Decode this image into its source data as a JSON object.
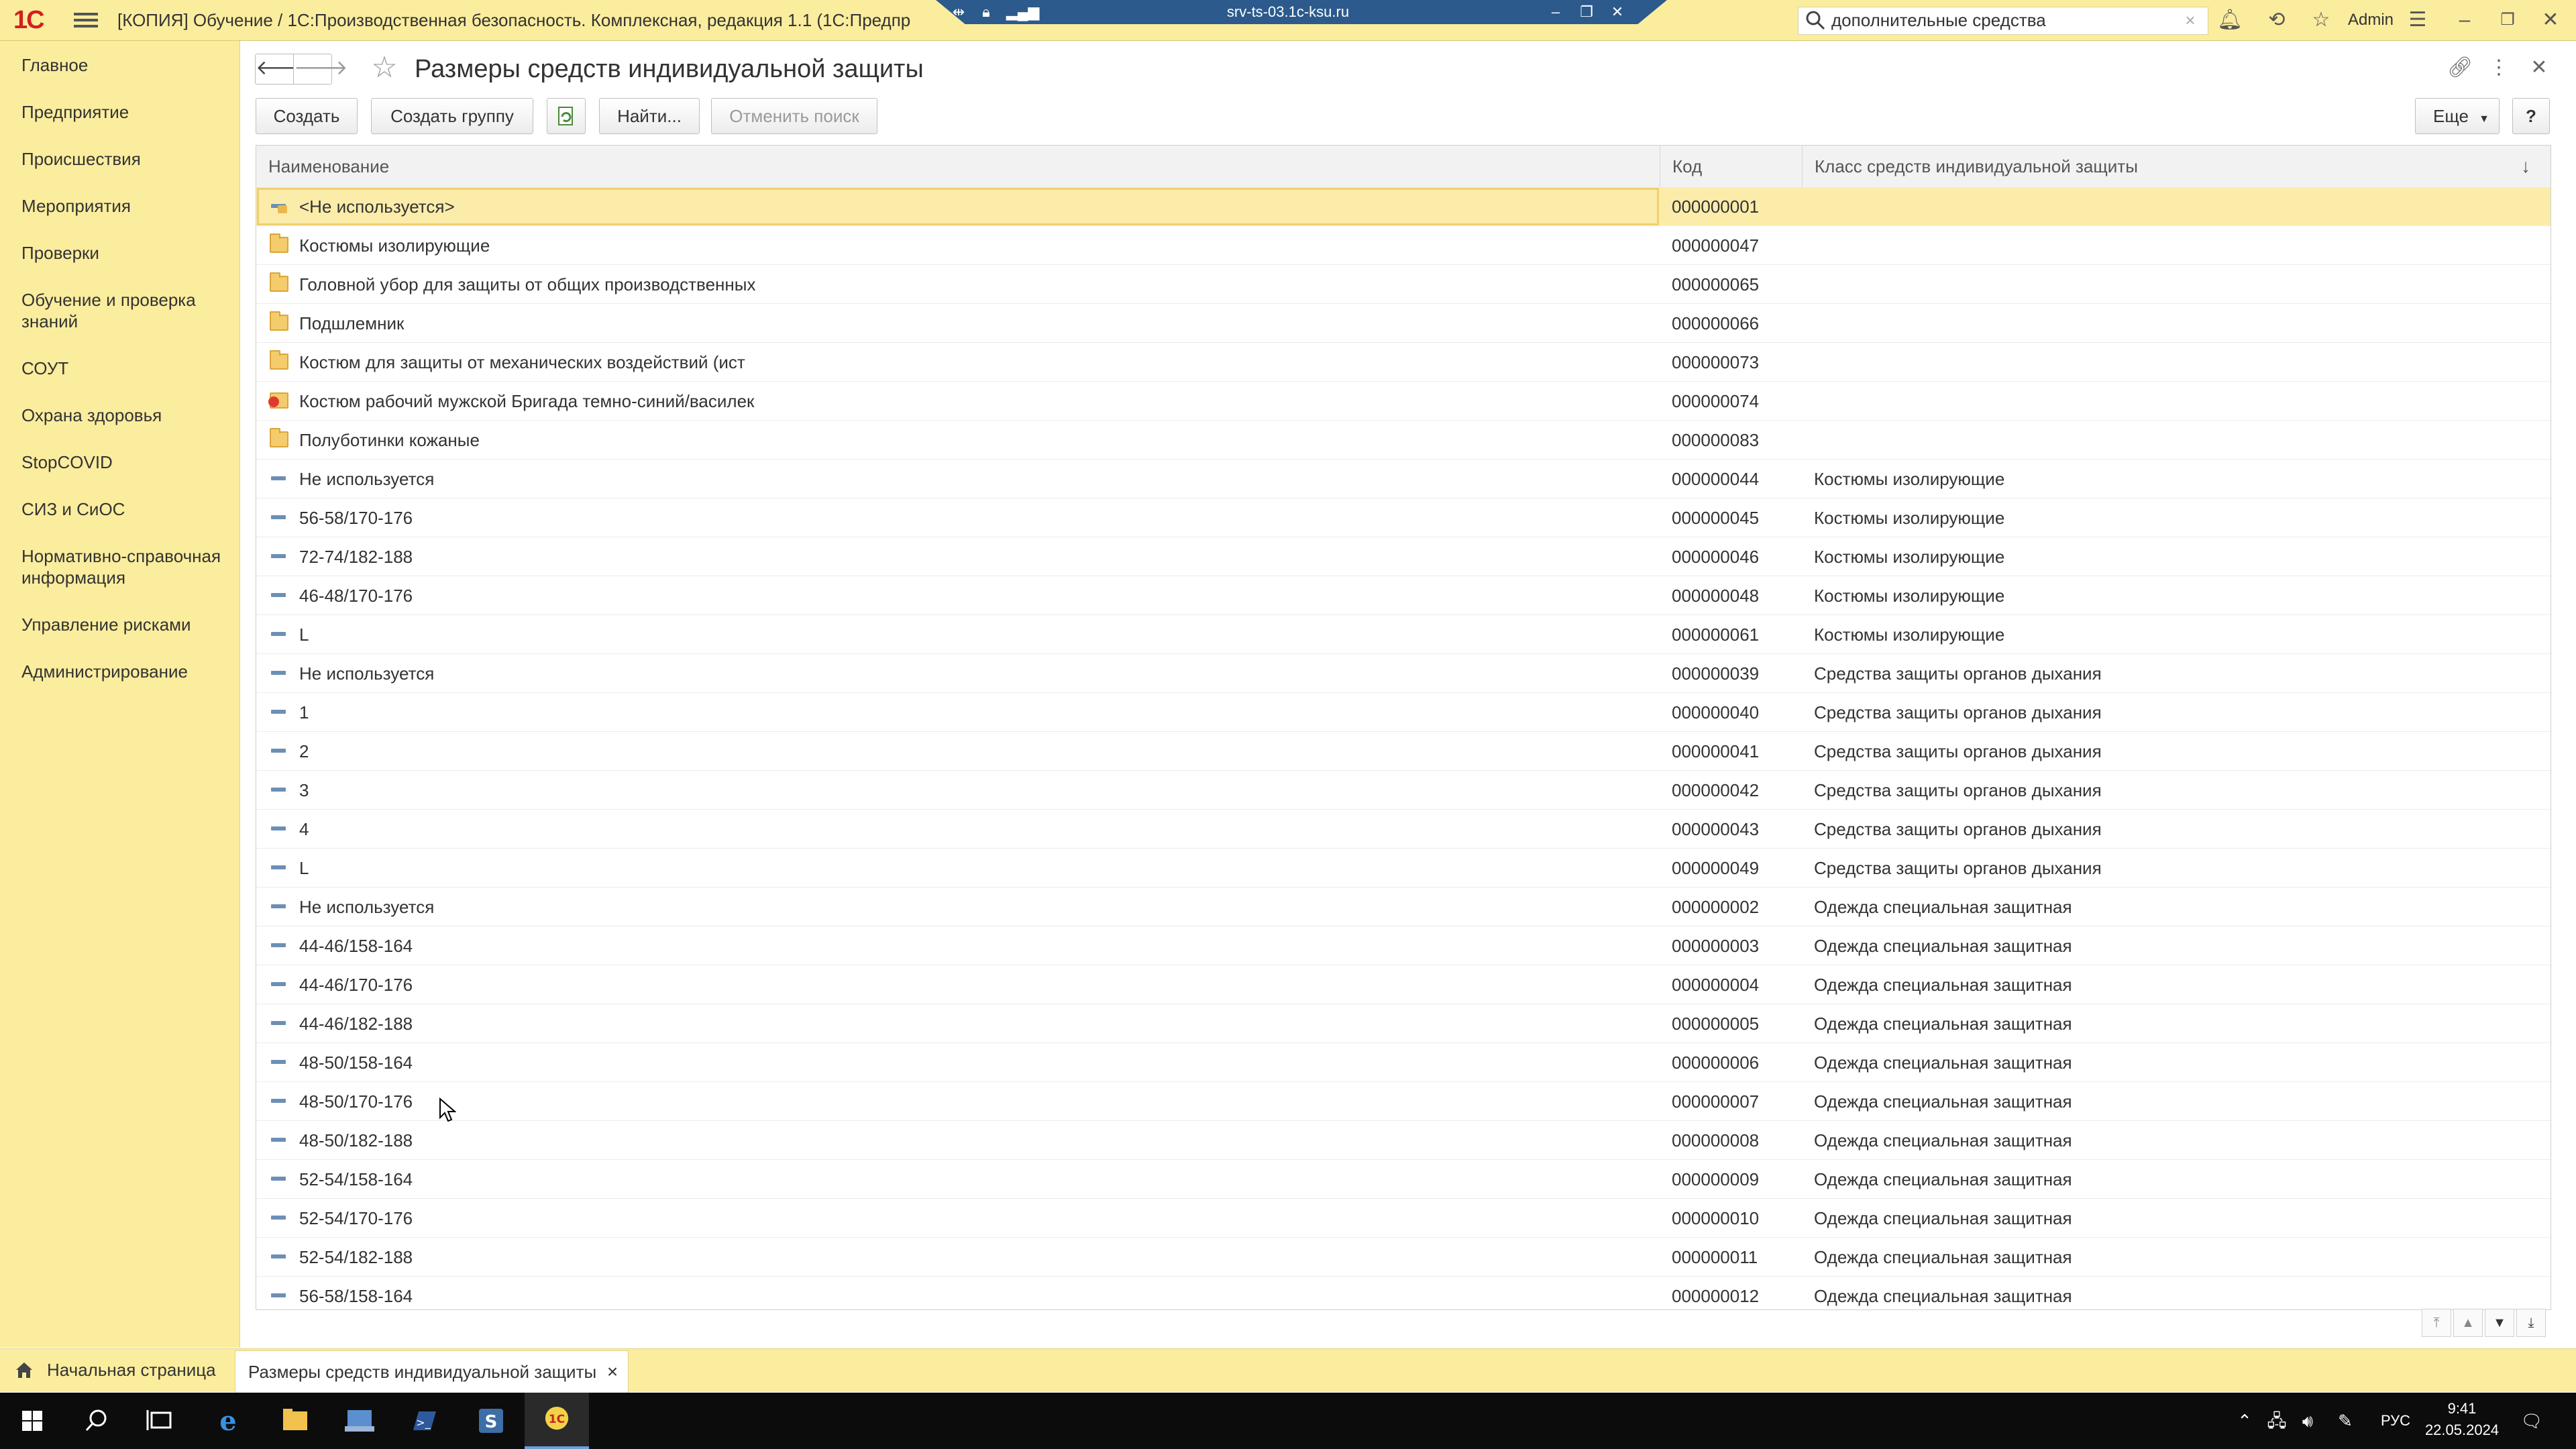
{
  "window": {
    "logo": "1С",
    "title": "[КОПИЯ] Обучение / 1С:Производственная безопасность. Комплексная, редакция 1.1  (1С:Предпр",
    "remote_host": "srv-ts-03.1c-ksu.ru",
    "search_value": "дополнительные средства",
    "username": "Admin"
  },
  "sidebar": {
    "items": [
      {
        "label": "Главное"
      },
      {
        "label": "Предприятие"
      },
      {
        "label": "Происшествия"
      },
      {
        "label": "Мероприятия"
      },
      {
        "label": "Проверки"
      },
      {
        "label": "Обучение и проверка знаний"
      },
      {
        "label": "СОУТ"
      },
      {
        "label": "Охрана здоровья"
      },
      {
        "label": "StopCOVID"
      },
      {
        "label": "СИЗ и СиОС"
      },
      {
        "label": "Нормативно-справочная информация"
      },
      {
        "label": "Управление рисками"
      },
      {
        "label": "Администрирование"
      }
    ]
  },
  "page": {
    "title": "Размеры средств индивидуальной защиты"
  },
  "toolbar": {
    "create": "Создать",
    "create_group": "Создать группу",
    "find": "Найти...",
    "cancel_search": "Отменить поиск",
    "more": "Еще",
    "help": "?"
  },
  "table": {
    "columns": [
      "Наименование",
      "Код",
      "Класс средств индивидуальной защиты"
    ],
    "rows": [
      {
        "icon": "item-unused",
        "name": "<Не используется>",
        "code": "000000001",
        "class": "",
        "selected": true
      },
      {
        "icon": "folder",
        "name": "Костюмы изолирующие",
        "code": "000000047",
        "class": ""
      },
      {
        "icon": "folder",
        "name": "Головной убор для защиты от общих производственных",
        "code": "000000065",
        "class": ""
      },
      {
        "icon": "folder",
        "name": "Подшлемник",
        "code": "000000066",
        "class": ""
      },
      {
        "icon": "folder",
        "name": "Костюм для защиты от механических воздействий (ист",
        "code": "000000073",
        "class": ""
      },
      {
        "icon": "marked",
        "name": "Костюм рабочий мужской Бригада темно-синий/василек",
        "code": "000000074",
        "class": ""
      },
      {
        "icon": "folder",
        "name": "Полуботинки кожаные",
        "code": "000000083",
        "class": ""
      },
      {
        "icon": "item",
        "name": "Не используется",
        "code": "000000044",
        "class": "Костюмы изолирующие"
      },
      {
        "icon": "item",
        "name": "56-58/170-176",
        "code": "000000045",
        "class": "Костюмы изолирующие"
      },
      {
        "icon": "item",
        "name": "72-74/182-188",
        "code": "000000046",
        "class": "Костюмы изолирующие"
      },
      {
        "icon": "item",
        "name": "46-48/170-176",
        "code": "000000048",
        "class": "Костюмы изолирующие"
      },
      {
        "icon": "item",
        "name": "L",
        "code": "000000061",
        "class": "Костюмы изолирующие"
      },
      {
        "icon": "item",
        "name": "Не используется",
        "code": "000000039",
        "class": "Средства защиты органов дыхания"
      },
      {
        "icon": "item",
        "name": "1",
        "code": "000000040",
        "class": "Средства защиты органов дыхания"
      },
      {
        "icon": "item",
        "name": "2",
        "code": "000000041",
        "class": "Средства защиты органов дыхания"
      },
      {
        "icon": "item",
        "name": "3",
        "code": "000000042",
        "class": "Средства защиты органов дыхания"
      },
      {
        "icon": "item",
        "name": "4",
        "code": "000000043",
        "class": "Средства защиты органов дыхания"
      },
      {
        "icon": "item",
        "name": "L",
        "code": "000000049",
        "class": "Средства защиты органов дыхания"
      },
      {
        "icon": "item",
        "name": "Не используется",
        "code": "000000002",
        "class": "Одежда специальная защитная"
      },
      {
        "icon": "item",
        "name": "44-46/158-164",
        "code": "000000003",
        "class": "Одежда специальная защитная"
      },
      {
        "icon": "item",
        "name": "44-46/170-176",
        "code": "000000004",
        "class": "Одежда специальная защитная"
      },
      {
        "icon": "item",
        "name": "44-46/182-188",
        "code": "000000005",
        "class": "Одежда специальная защитная"
      },
      {
        "icon": "item",
        "name": "48-50/158-164",
        "code": "000000006",
        "class": "Одежда специальная защитная"
      },
      {
        "icon": "item",
        "name": "48-50/170-176",
        "code": "000000007",
        "class": "Одежда специальная защитная"
      },
      {
        "icon": "item",
        "name": "48-50/182-188",
        "code": "000000008",
        "class": "Одежда специальная защитная"
      },
      {
        "icon": "item",
        "name": "52-54/158-164",
        "code": "000000009",
        "class": "Одежда специальная защитная"
      },
      {
        "icon": "item",
        "name": "52-54/170-176",
        "code": "000000010",
        "class": "Одежда специальная защитная"
      },
      {
        "icon": "item",
        "name": "52-54/182-188",
        "code": "000000011",
        "class": "Одежда специальная защитная"
      },
      {
        "icon": "item",
        "name": "56-58/158-164",
        "code": "000000012",
        "class": "Одежда специальная защитная"
      }
    ]
  },
  "open_tabs": {
    "home": "Начальная страница",
    "active": "Размеры средств индивидуальной защиты"
  },
  "taskbar": {
    "language": "РУС",
    "time": "9:41",
    "date": "22.05.2024"
  },
  "colors": {
    "panel": "#fbed9e",
    "selection": "#fcecaa",
    "taskbar": "#0c0c0c"
  }
}
